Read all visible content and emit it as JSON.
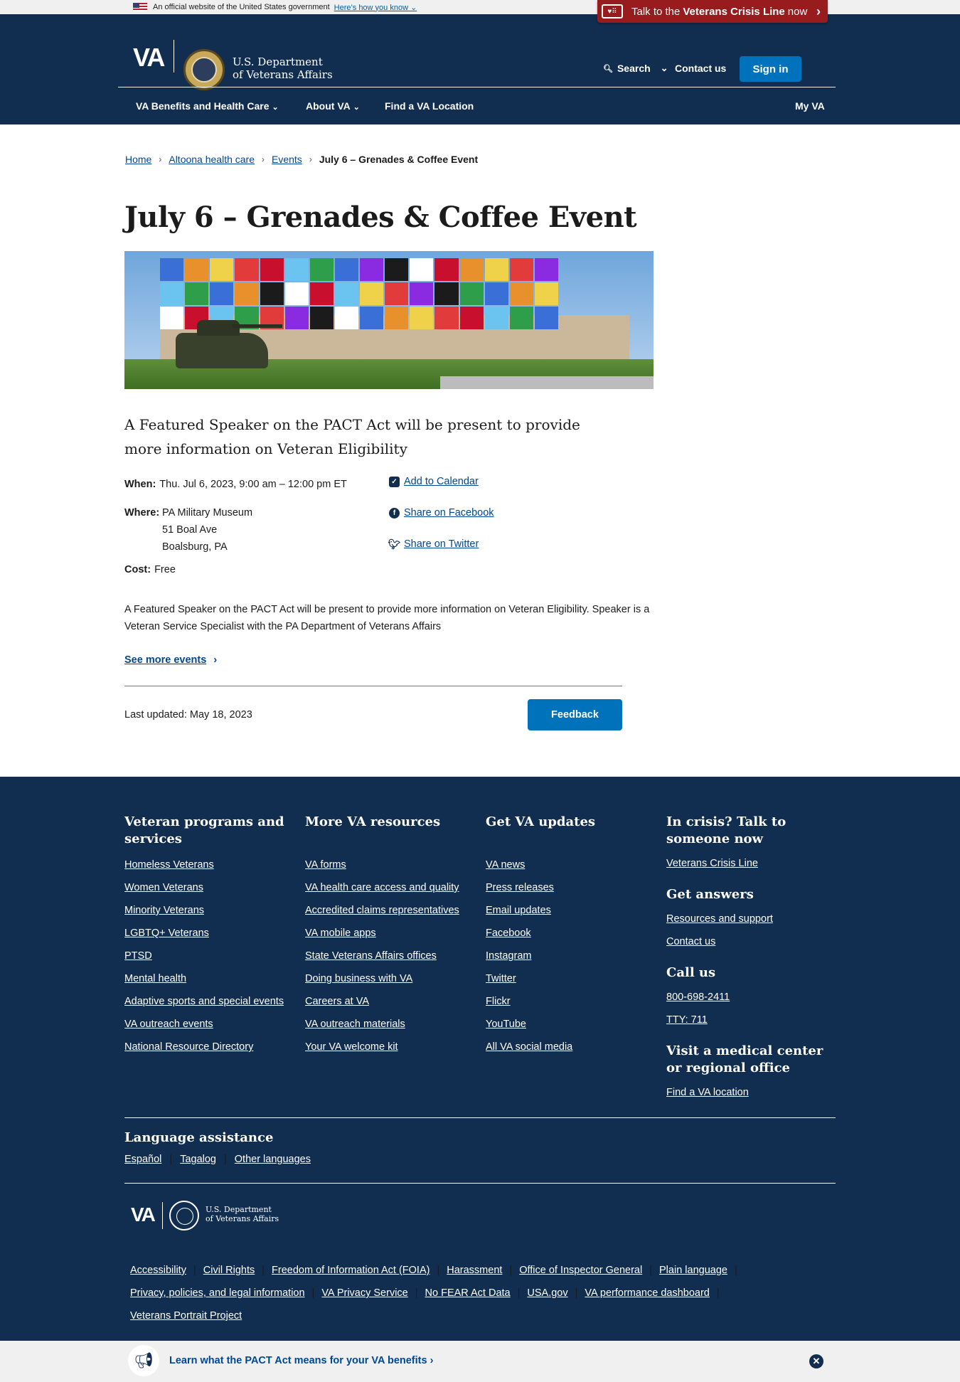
{
  "gov_banner": {
    "text": "An official website of the United States government",
    "link": "Here’s how you know"
  },
  "crisis_banner": {
    "prefix": "Talk to the",
    "strong": "Veterans Crisis Line",
    "suffix": "now"
  },
  "header": {
    "logo_text": "VA",
    "dept_line1": "U.S. Department",
    "dept_line2": "of Veterans Affairs",
    "search_label": "Search",
    "contact_label": "Contact us",
    "signin_label": "Sign in"
  },
  "nav": {
    "benefits": "VA Benefits and Health Care",
    "about": "About VA",
    "find": "Find a VA Location",
    "myva": "My VA"
  },
  "breadcrumb": [
    "Home",
    "Altoona health care",
    "Events",
    "July 6 – Grenades & Coffee Event"
  ],
  "event": {
    "title": "July 6 – Grenades & Coffee Event",
    "lead": "A Featured Speaker on the PACT Act will be present to provide more information on Veteran Eligibility",
    "when_label": "When:",
    "when_value": "Thu. Jul 6, 2023, 9:00 am – 12:00 pm ET",
    "where_label": "Where:",
    "where_lines": [
      "PA Military Museum",
      "51 Boal Ave",
      "Boalsburg, PA"
    ],
    "cost_label": "Cost:",
    "cost_value": "Free",
    "add_calendar": "Add to Calendar",
    "share_facebook": "Share on Facebook",
    "share_twitter": "Share on Twitter",
    "body": "A Featured Speaker on the PACT Act will be present to provide more information on Veteran Eligibility. Speaker is a Veteran Service Specialist with the PA Department of Veterans Affairs",
    "see_more": "See more events",
    "last_updated": "Last updated: May 18, 2023",
    "feedback": "Feedback"
  },
  "footer": {
    "col1": {
      "title": "Veteran programs and services",
      "links": [
        "Homeless Veterans",
        "Women Veterans",
        "Minority Veterans",
        "LGBTQ+ Veterans",
        "PTSD",
        "Mental health",
        "Adaptive sports and special events",
        "VA outreach events",
        "National Resource Directory"
      ]
    },
    "col2": {
      "title": "More VA resources",
      "links": [
        "VA forms",
        "VA health care access and quality",
        "Accredited claims representatives",
        "VA mobile apps",
        "State Veterans Affairs offices",
        "Doing business with VA",
        "Careers at VA",
        "VA outreach materials",
        "Your VA welcome kit"
      ]
    },
    "col3": {
      "title": "Get VA updates",
      "links": [
        "VA news",
        "Press releases",
        "Email updates",
        "Facebook",
        "Instagram",
        "Twitter",
        "Flickr",
        "YouTube",
        "All VA social media"
      ]
    },
    "col4": {
      "crisis_title": "In crisis? Talk to someone now",
      "crisis_link": "Veterans Crisis Line",
      "answers_title": "Get answers",
      "answers_links": [
        "Resources and support",
        "Contact us"
      ],
      "call_title": "Call us",
      "call_links": [
        "800-698-2411",
        "TTY: 711"
      ],
      "visit_title": "Visit a medical center or regional office",
      "visit_link": "Find a VA location"
    },
    "language_title": "Language assistance",
    "languages": [
      "Español",
      "Tagalog",
      "Other languages"
    ],
    "logo_text": "VA",
    "dept_line1": "U.S. Department",
    "dept_line2": "of Veterans Affairs",
    "legal_links": [
      "Accessibility",
      "Civil Rights",
      "Freedom of Information Act (FOIA)",
      "Harassment",
      "Office of Inspector General",
      "Plain language",
      "Privacy, policies, and legal information",
      "VA Privacy Service",
      "No FEAR Act Data",
      "USA.gov",
      "VA performance dashboard",
      "Veterans Portrait Project"
    ]
  },
  "promo": {
    "text": "Learn what the PACT Act means for your VA benefits"
  },
  "colors": {
    "navy": "#112e51",
    "primary_blue": "#0071bb",
    "link_blue": "#004795",
    "crisis_red": "#981b1e"
  }
}
